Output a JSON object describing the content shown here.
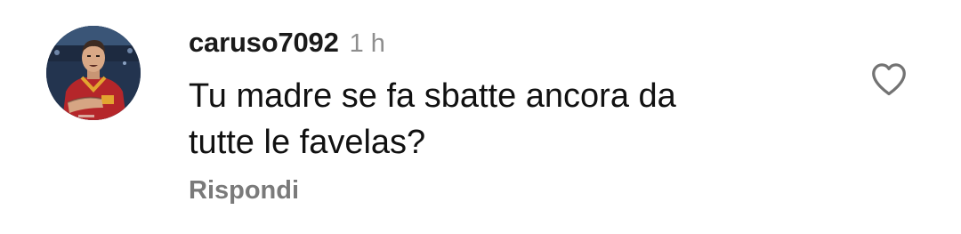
{
  "comment": {
    "username": "caruso7092",
    "timestamp": "1 h",
    "text_line_1": "Tu madre se fa sbatte ancora da",
    "text_line_2": "tutte le favelas?",
    "reply_label": "Rispondi"
  },
  "icons": {
    "like": "heart-outline-icon",
    "avatar": "profile-photo"
  },
  "colors": {
    "username": "#1a1a1a",
    "timestamp": "#8e8e8e",
    "reply": "#7a7a7a",
    "heart_stroke": "#737373"
  }
}
